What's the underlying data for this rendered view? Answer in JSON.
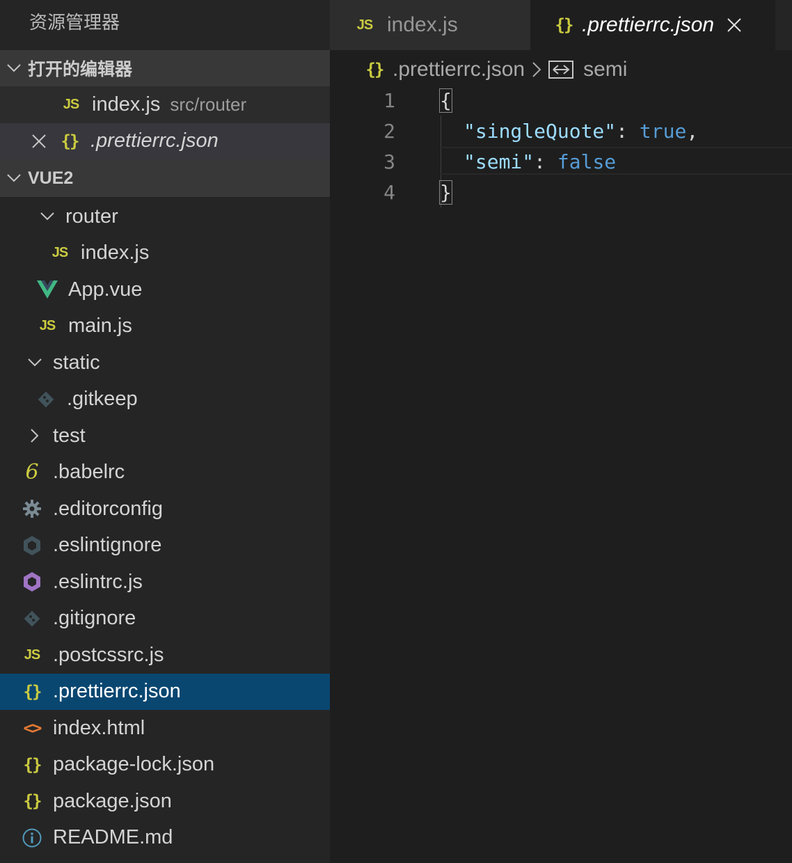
{
  "sidebar": {
    "title": "资源管理器",
    "open_editors": {
      "title": "打开的编辑器",
      "items": [
        {
          "icon": "js-icon",
          "label": "index.js",
          "desc": "src/router"
        },
        {
          "icon": "json-icon",
          "label": ".prettierrc.json",
          "desc": ""
        }
      ]
    },
    "project": {
      "title": "VUE2",
      "items": [
        {
          "label": "router"
        },
        {
          "label": "index.js"
        },
        {
          "label": "App.vue"
        },
        {
          "label": "main.js"
        },
        {
          "label": "static"
        },
        {
          "label": ".gitkeep"
        },
        {
          "label": "test"
        },
        {
          "label": ".babelrc"
        },
        {
          "label": ".editorconfig"
        },
        {
          "label": ".eslintignore"
        },
        {
          "label": ".eslintrc.js"
        },
        {
          "label": ".gitignore"
        },
        {
          "label": ".postcssrc.js"
        },
        {
          "label": ".prettierrc.json"
        },
        {
          "label": "index.html"
        },
        {
          "label": "package-lock.json"
        },
        {
          "label": "package.json"
        },
        {
          "label": "README.md"
        }
      ]
    }
  },
  "tabs": [
    {
      "label": "index.js",
      "icon": "js-icon"
    },
    {
      "label": ".prettierrc.json",
      "icon": "json-icon",
      "active": true
    }
  ],
  "breadcrumb": {
    "file": ".prettierrc.json",
    "symbol": "semi"
  },
  "editor": {
    "line_numbers": [
      "1",
      "2",
      "3",
      "4"
    ],
    "lines": {
      "l1": "{",
      "l2_key": "\"singleQuote\"",
      "l2_colon": ": ",
      "l2_val": "true",
      "l2_comma": ",",
      "l3_key": "\"semi\"",
      "l3_colon": ": ",
      "l3_val": "false",
      "l4": "}"
    }
  },
  "icons": {
    "js": "JS",
    "json": "{}",
    "html": "<>",
    "babel": "6"
  },
  "colors": {
    "active_row": "#094771",
    "js_yellow": "#cbcb41",
    "json_key": "#9cdcfe",
    "json_bool": "#569cd6"
  }
}
